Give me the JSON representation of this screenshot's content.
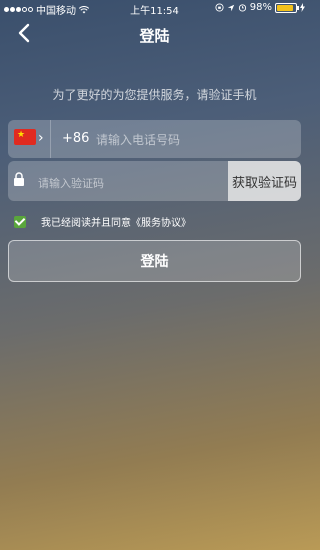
{
  "status_bar": {
    "carrier": "中国移动",
    "time": "上午11:54",
    "battery_percent": "98%",
    "battery_color": "#f3c21c"
  },
  "nav": {
    "title": "登陆",
    "back_icon": "chevron-left-icon"
  },
  "prompt_text": "为了更好的为您提供服务，请验证手机",
  "phone": {
    "country_code": "+86",
    "placeholder": "请输入电话号码",
    "flag_icon": "china-flag-icon"
  },
  "verify": {
    "placeholder": "请输入验证码",
    "get_code_label": "获取验证码",
    "lock_icon": "lock-icon"
  },
  "agreement": {
    "checked": true,
    "text": "我已经阅读并且同意《服务协议》"
  },
  "login_button": "登陆"
}
